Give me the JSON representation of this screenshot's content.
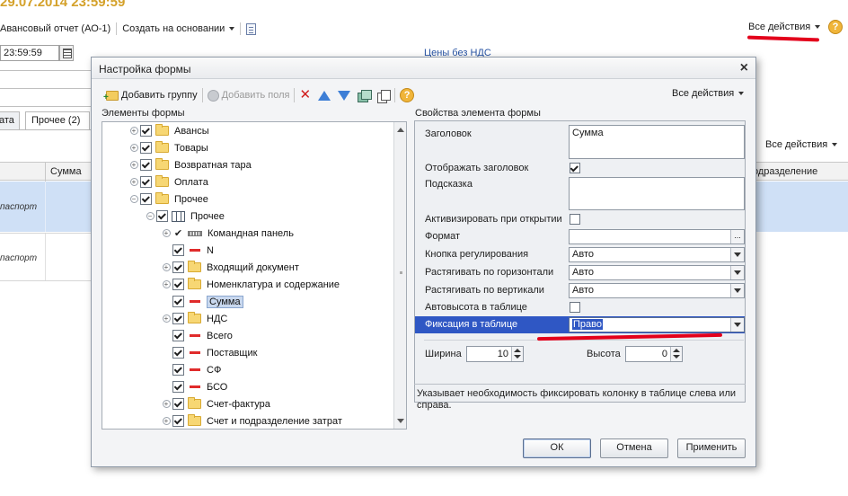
{
  "background": {
    "title": "29.07.2014 23:59:59",
    "toolbar": {
      "report_label": "Авансовый отчет (АО-1)",
      "create_based_label": "Создать на основании",
      "all_actions_label": "Все действия",
      "help_label": "?"
    },
    "date_value": "23:59:59",
    "prices_link": "Цены без НДС",
    "tabs": [
      {
        "label": "ата"
      },
      {
        "label": "Прочее (2)"
      }
    ],
    "grid_all_actions_label": "Все действия",
    "columns": {
      "sum": "Сумма",
      "subdivision": "одразделение"
    },
    "rows": [
      {
        "cell": "паспорт"
      },
      {
        "cell": "паспорт"
      }
    ]
  },
  "dialog": {
    "title": "Настройка формы",
    "close_label": "×",
    "toolbar": {
      "add_group_label": "Добавить группу",
      "add_fields_label": "Добавить поля",
      "help_label": "?",
      "all_actions_label": "Все действия"
    },
    "elements_header": "Элементы формы",
    "properties_header": "Свойства элемента формы",
    "tree": [
      {
        "label": "Авансы",
        "level": 0,
        "expander": true,
        "check": true,
        "icon": "folder"
      },
      {
        "label": "Товары",
        "level": 0,
        "expander": true,
        "check": true,
        "icon": "folder"
      },
      {
        "label": "Возвратная тара",
        "level": 0,
        "expander": true,
        "check": true,
        "icon": "folder"
      },
      {
        "label": "Оплата",
        "level": 0,
        "expander": true,
        "check": true,
        "icon": "folder"
      },
      {
        "label": "Прочее",
        "level": 0,
        "expander": true,
        "expanded": true,
        "check": true,
        "icon": "folder"
      },
      {
        "label": "Прочее",
        "level": 1,
        "expander": true,
        "expanded": true,
        "check": true,
        "icon": "table"
      },
      {
        "label": "Командная панель",
        "level": 2,
        "expander": true,
        "check": "mark",
        "icon": "command-panel"
      },
      {
        "label": "N",
        "level": 2,
        "expander": false,
        "check": true,
        "icon": "field"
      },
      {
        "label": "Входящий документ",
        "level": 2,
        "expander": true,
        "check": true,
        "icon": "folder"
      },
      {
        "label": "Номенклатура и содержание",
        "level": 2,
        "expander": true,
        "check": true,
        "icon": "folder"
      },
      {
        "label": "Сумма",
        "level": 2,
        "expander": false,
        "check": true,
        "icon": "field",
        "selected": true
      },
      {
        "label": "НДС",
        "level": 2,
        "expander": true,
        "check": true,
        "icon": "folder"
      },
      {
        "label": "Всего",
        "level": 2,
        "expander": false,
        "check": true,
        "icon": "field"
      },
      {
        "label": "Поставщик",
        "level": 2,
        "expander": false,
        "check": true,
        "icon": "field"
      },
      {
        "label": "СФ",
        "level": 2,
        "expander": false,
        "check": true,
        "icon": "field"
      },
      {
        "label": "БСО",
        "level": 2,
        "expander": false,
        "check": true,
        "icon": "field"
      },
      {
        "label": "Счет-фактура",
        "level": 2,
        "expander": true,
        "check": true,
        "icon": "folder"
      },
      {
        "label": "Счет и подразделение затрат",
        "level": 2,
        "expander": true,
        "check": true,
        "icon": "folder"
      }
    ],
    "properties": {
      "header_label": "Заголовок",
      "header_value": "Сумма",
      "show_header_label": "Отображать заголовок",
      "show_header_checked": true,
      "tooltip_label": "Подсказка",
      "tooltip_value": "",
      "activate_on_open_label": "Активизировать при открытии",
      "activate_on_open_checked": false,
      "format_label": "Формат",
      "format_value": "",
      "format_button_label": "...",
      "adjust_button_label": "Кнопка регулирования",
      "adjust_button_value": "Авто",
      "stretch_h_label": "Растягивать по горизонтали",
      "stretch_h_value": "Авто",
      "stretch_v_label": "Растягивать по вертикали",
      "stretch_v_value": "Авто",
      "autoheight_label": "Автовысота в таблице",
      "autoheight_checked": false,
      "fixing_label": "Фиксация в таблице",
      "fixing_value": "Право",
      "width_label": "Ширина",
      "width_value": "10",
      "height_label": "Высота",
      "height_value": "0"
    },
    "hint_text": "Указывает необходимость фиксировать колонку в таблице слева или справа.",
    "buttons": {
      "ok": "ОК",
      "cancel": "Отмена",
      "apply": "Применить"
    }
  },
  "colors": {
    "annotation_red": "#e3001b",
    "selection_blue": "#2f57c4",
    "title_gold": "#d4a12a"
  }
}
